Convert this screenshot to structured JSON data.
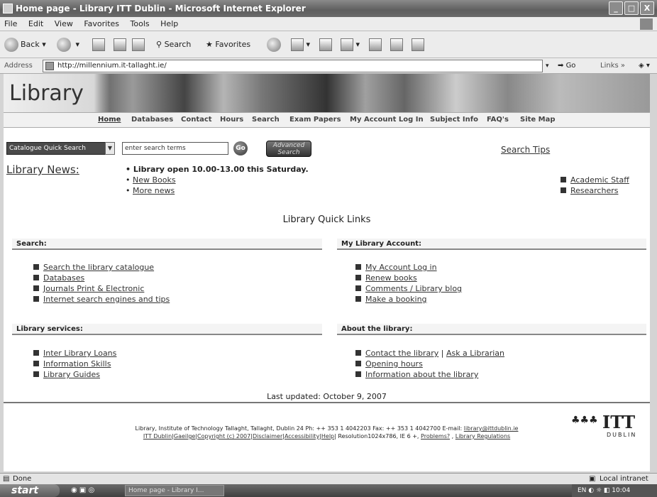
{
  "window": {
    "title": "Home page - Library ITT Dublin - Microsoft Internet Explorer",
    "min": "_",
    "max": "□",
    "close": "X"
  },
  "menu": [
    "File",
    "Edit",
    "View",
    "Favorites",
    "Tools",
    "Help"
  ],
  "toolbar": {
    "back": "Back",
    "search": "Search",
    "favorites": "Favorites"
  },
  "address": {
    "label": "Address",
    "url": "http://millennium.it-tallaght.ie/",
    "go": "Go",
    "links": "Links"
  },
  "banner": {
    "logo": "Library"
  },
  "nav": [
    "Home",
    "Databases",
    "Contact",
    "Hours",
    "Search",
    "Exam Papers",
    "My Account Log In",
    "Subject Info",
    "FAQ's",
    "Site Map"
  ],
  "quick_search": {
    "select": "Catalogue Quick Search",
    "placeholder": "enter search terms",
    "go": "Go",
    "advanced": [
      "Advanced",
      "Search"
    ],
    "tips": "Search Tips"
  },
  "news": {
    "heading": "Library News:",
    "items": [
      "Library open 10.00-13.00 this Saturday.",
      "New Books",
      "More news"
    ]
  },
  "side_links": [
    "Academic Staff",
    "Researchers"
  ],
  "quick_links_title": "Library Quick Links",
  "sections": {
    "search": {
      "title": "Search:",
      "items": [
        "Search the library catalogue",
        "Databases",
        "Journals Print & Electronic",
        "Internet search engines and tips"
      ]
    },
    "account": {
      "title": "My Library Account:",
      "items": [
        "My Account Log in",
        "Renew books",
        "Comments / Library blog",
        "Make a booking"
      ]
    },
    "services": {
      "title": "Library services:",
      "items": [
        "Inter Library Loans",
        "Information Skills",
        "Library Guides"
      ]
    },
    "about": {
      "title": "About the library:",
      "items": [
        "Contact the library",
        "Ask a Librarian",
        "Opening hours",
        "Information about the library"
      ]
    }
  },
  "updated": "Last updated: October 9, 2007",
  "footer": {
    "line1": "Library, Institute of Technology Tallaght, Tallaght, Dublin 24 Ph: ++ 353 1 4042203 Fax: ++ 353 1 4042700 E-mail: ",
    "email": "library@ittdublin.ie",
    "links": [
      "ITT Dublin",
      "Gaeilge",
      "Copyright (c) 2007",
      "Disclaimer",
      "Accessibility",
      "Help"
    ],
    "resolution": " Resolution1024x786, IE 6 +, ",
    "problems": "Problems?",
    "regs": "Library Regulations",
    "logo": "ITT",
    "logo_sub": "DUBLIN"
  },
  "status": {
    "left": "Done",
    "zone": "Local intranet"
  },
  "taskbar": {
    "start": "start",
    "task": "Home page - Library I...",
    "lang": "EN",
    "clock": "10:04"
  }
}
